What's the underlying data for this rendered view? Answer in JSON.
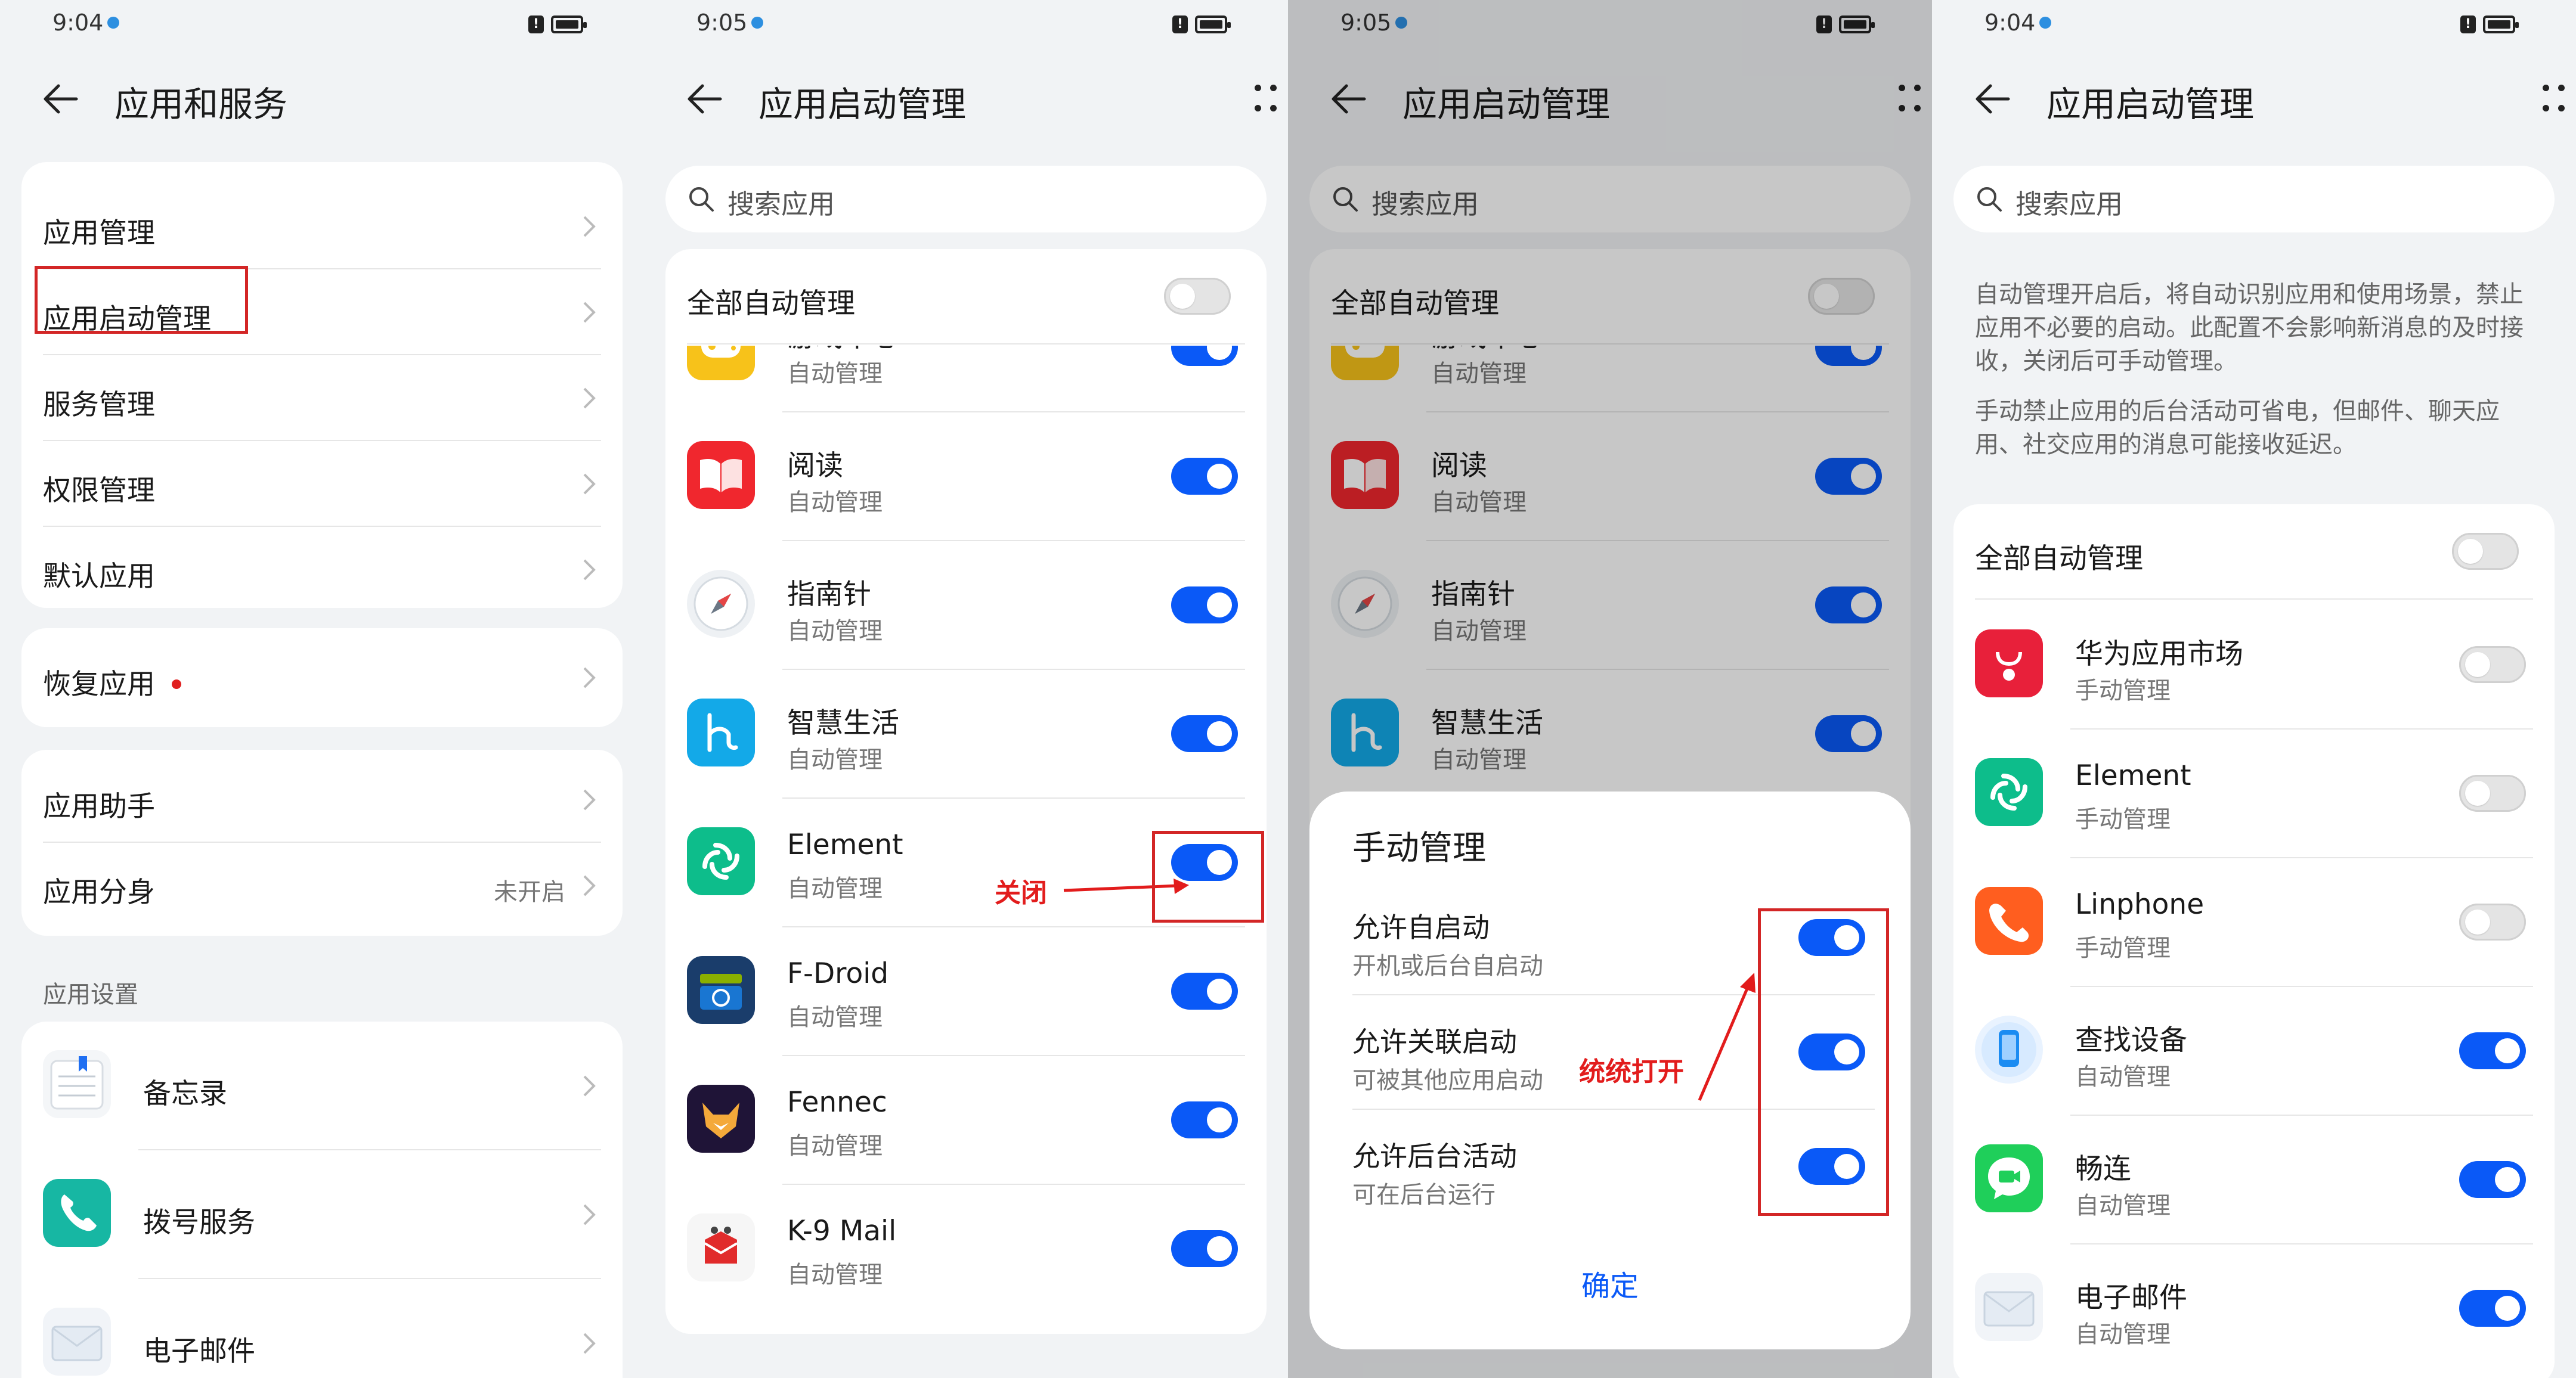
{
  "colors": {
    "accent": "#0a59f7",
    "annotation_red": "#d32626",
    "bg": "#f1f3f5"
  },
  "panel1": {
    "time": "9:04",
    "title": "应用和服务",
    "group1": [
      "应用管理",
      "应用启动管理",
      "服务管理",
      "权限管理",
      "默认应用"
    ],
    "group2": [
      "恢复应用"
    ],
    "group3": [
      {
        "label": "应用助手",
        "value": ""
      },
      {
        "label": "应用分身",
        "value": "未开启"
      }
    ],
    "section_label": "应用设置",
    "settings_apps": [
      "备忘录",
      "拨号服务",
      "电子邮件"
    ]
  },
  "panel2": {
    "time": "9:05",
    "title": "应用启动管理",
    "search_placeholder": "搜索应用",
    "all_auto_label": "全部自动管理",
    "apps": [
      {
        "name": "游戏中心",
        "sub": "自动管理",
        "on": true
      },
      {
        "name": "阅读",
        "sub": "自动管理",
        "on": true
      },
      {
        "name": "指南针",
        "sub": "自动管理",
        "on": true
      },
      {
        "name": "智慧生活",
        "sub": "自动管理",
        "on": true
      },
      {
        "name": "Element",
        "sub": "自动管理",
        "on": true
      },
      {
        "name": "F-Droid",
        "sub": "自动管理",
        "on": true
      },
      {
        "name": "Fennec",
        "sub": "自动管理",
        "on": true
      },
      {
        "name": "K-9 Mail",
        "sub": "自动管理",
        "on": true
      }
    ],
    "annotation": "关闭"
  },
  "panel3": {
    "time": "9:05",
    "title": "应用启动管理",
    "search_placeholder": "搜索应用",
    "all_auto_label": "全部自动管理",
    "apps": [
      {
        "name": "游戏中心",
        "sub": "自动管理"
      },
      {
        "name": "阅读",
        "sub": "自动管理"
      },
      {
        "name": "指南针",
        "sub": "自动管理"
      },
      {
        "name": "智慧生活",
        "sub": "自动管理"
      }
    ],
    "dialog": {
      "title": "手动管理",
      "options": [
        {
          "label": "允许自启动",
          "sub": "开机或后台自启动",
          "on": true
        },
        {
          "label": "允许关联启动",
          "sub": "可被其他应用启动",
          "on": true
        },
        {
          "label": "允许后台活动",
          "sub": "可在后台运行",
          "on": true
        }
      ],
      "confirm": "确定"
    },
    "annotation": "统统打开"
  },
  "panel4": {
    "time": "9:04",
    "title": "应用启动管理",
    "search_placeholder": "搜索应用",
    "desc1": "自动管理开启后，将自动识别应用和使用场景，禁止应用不必要的启动。此配置不会影响新消息的及时接收，关闭后可手动管理。",
    "desc2": "手动禁止应用的后台活动可省电，但邮件、聊天应用、社交应用的消息可能接收延迟。",
    "all_auto_label": "全部自动管理",
    "apps": [
      {
        "name": "华为应用市场",
        "sub": "手动管理",
        "on": false
      },
      {
        "name": "Element",
        "sub": "手动管理",
        "on": false
      },
      {
        "name": "Linphone",
        "sub": "手动管理",
        "on": false
      },
      {
        "name": "查找设备",
        "sub": "自动管理",
        "on": true
      },
      {
        "name": "畅连",
        "sub": "自动管理",
        "on": true
      },
      {
        "name": "电子邮件",
        "sub": "自动管理",
        "on": true
      }
    ]
  }
}
